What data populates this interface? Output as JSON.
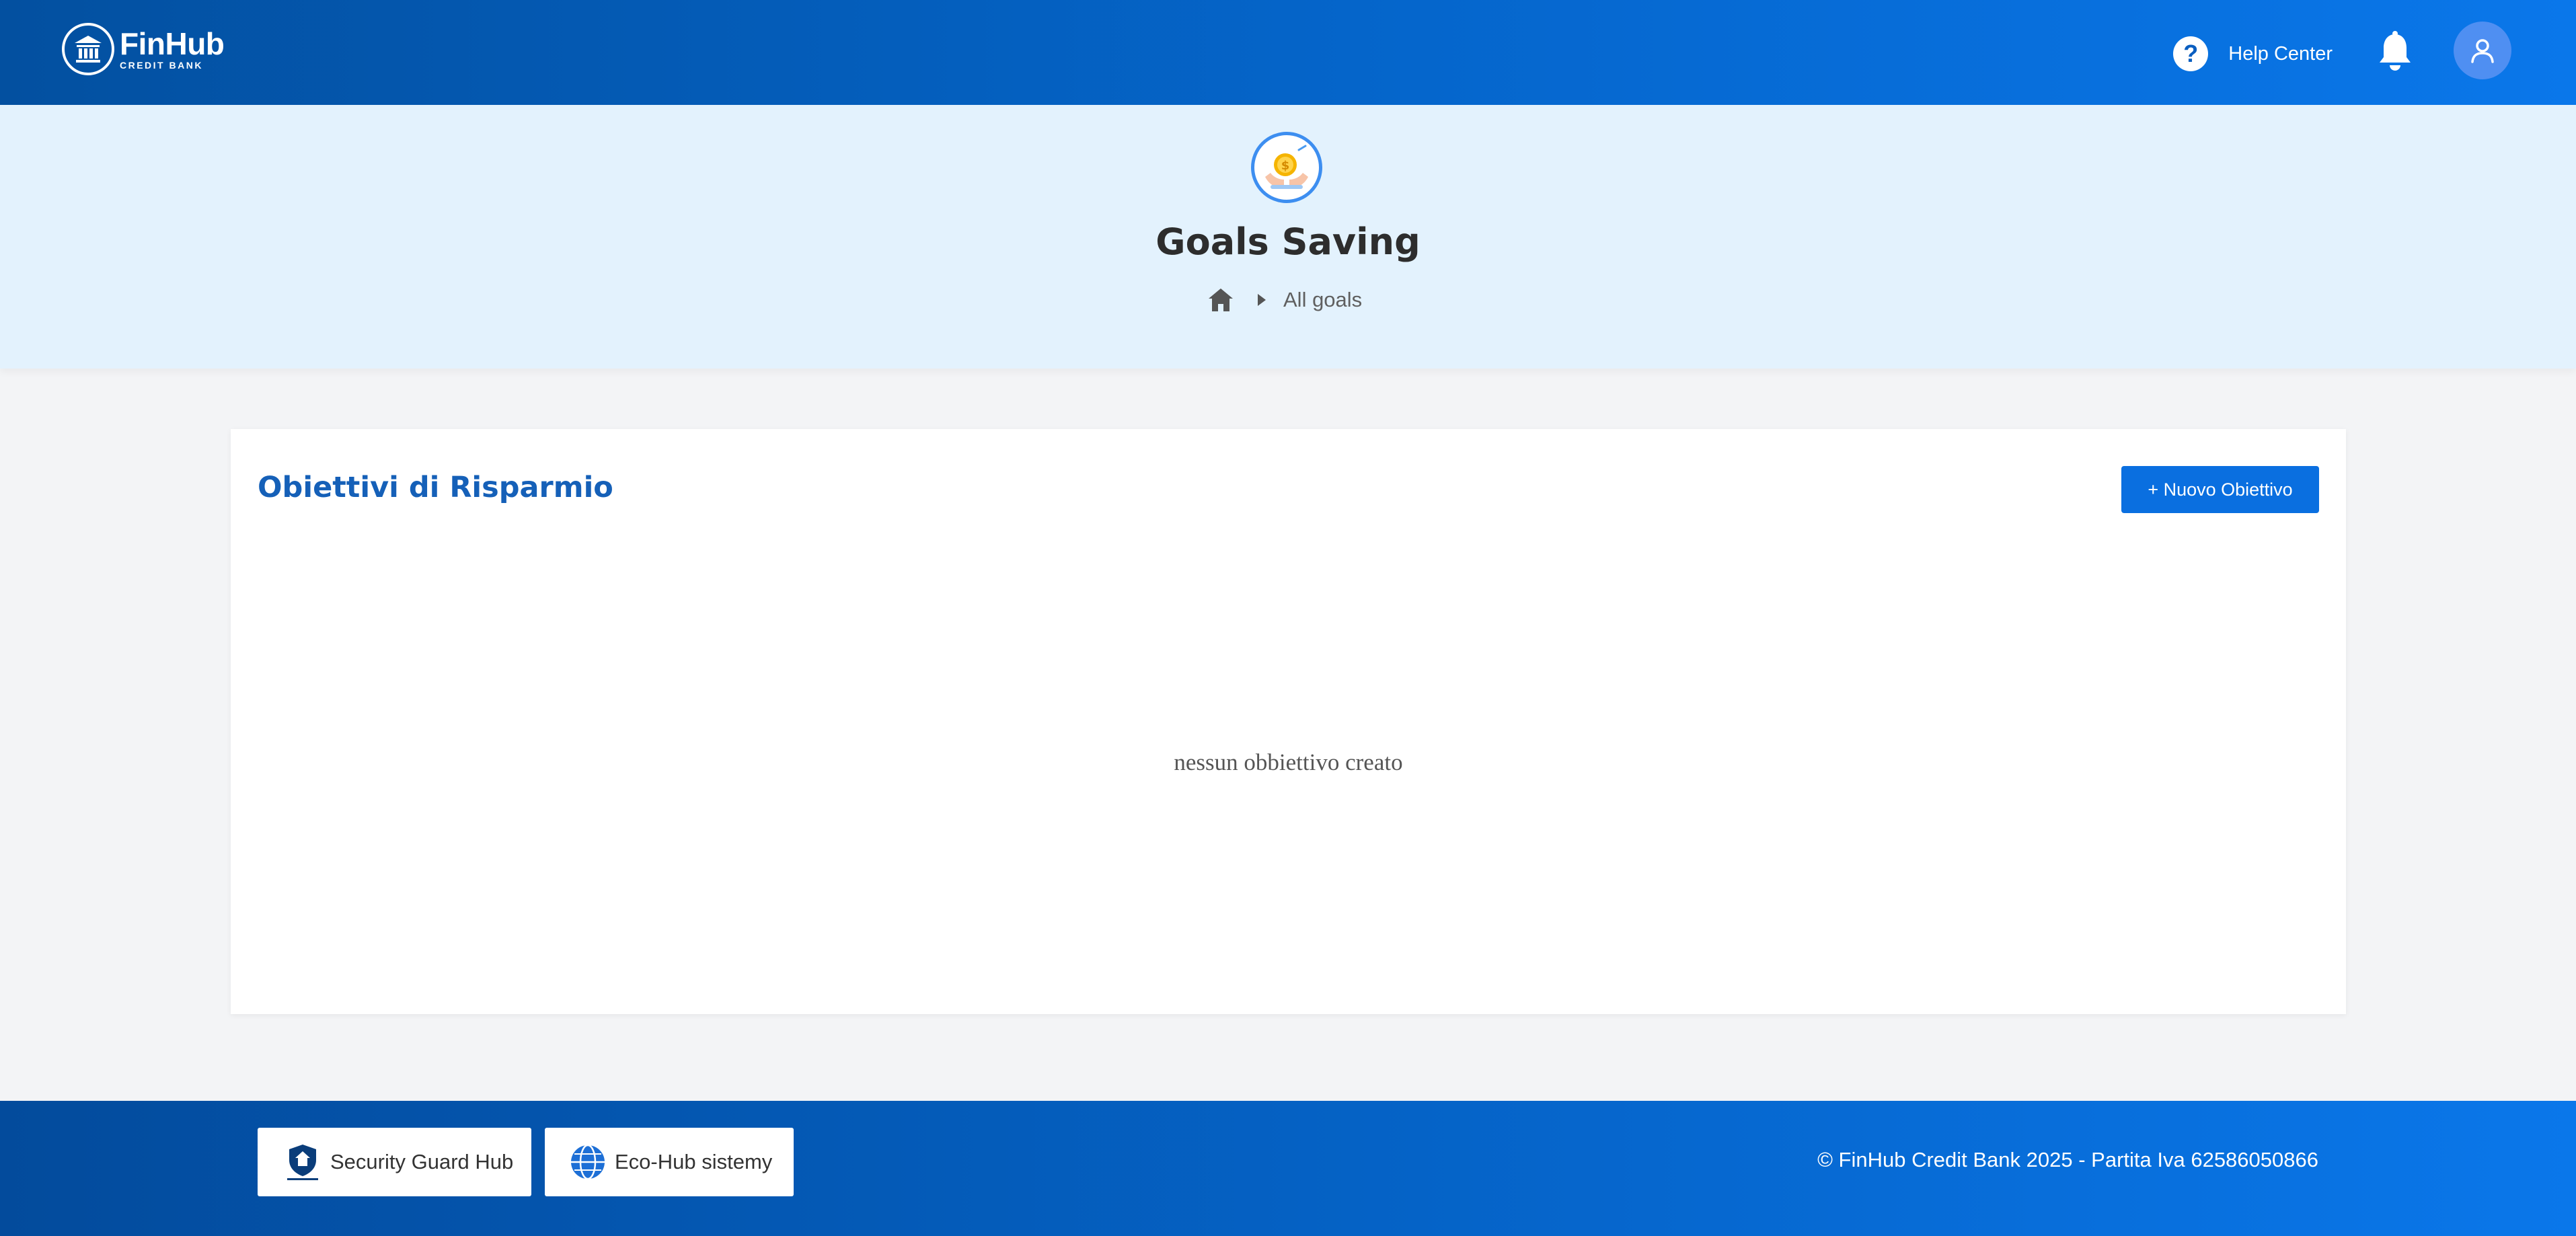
{
  "header": {
    "brand_name": "FinHub",
    "brand_sub": "CREDIT BANK",
    "help_label": "Help Center",
    "help_icon": "question-icon",
    "bell_icon": "bell-icon",
    "avatar_icon": "user-icon",
    "accent": "#0566cc"
  },
  "hero": {
    "title": "Goals Saving",
    "icon": "savings-coin-icon",
    "breadcrumb": {
      "home_icon": "home-icon",
      "separator_icon": "caret-right-icon",
      "current": "All goals"
    }
  },
  "main": {
    "title": "Obiettivi di Risparmio",
    "new_button_label": "+ Nuovo Obiettivo",
    "empty_message": "nessun obbiettivo creato"
  },
  "footer": {
    "partners": [
      {
        "label": "Security Guard Hub",
        "icon": "shield-logo-icon"
      },
      {
        "label": "Eco-Hub sistemy",
        "icon": "globe-icon"
      }
    ],
    "copyright": "© FinHub Credit Bank 2025 - Partita Iva 62586050866"
  }
}
